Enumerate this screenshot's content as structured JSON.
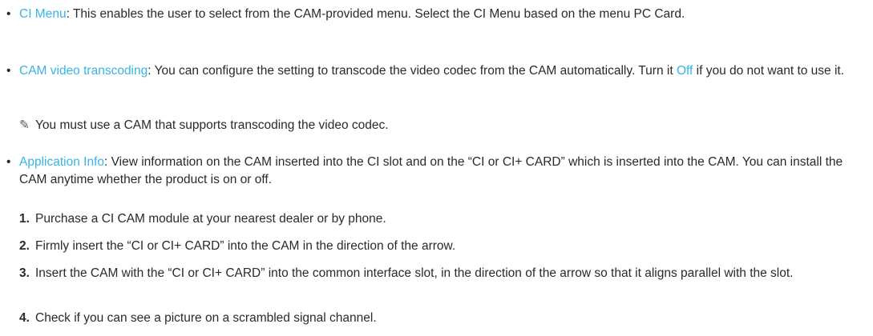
{
  "items": [
    {
      "term": "CI Menu",
      "text": ": This enables the user to select from the CAM-provided menu. Select the CI Menu based on the menu PC Card."
    },
    {
      "term": "CAM video transcoding",
      "text_before": ": You can configure the setting to transcode the video codec from the CAM automatically. Turn it ",
      "accent": "Off",
      "text_after": " if you do not want to use it."
    },
    {
      "term": "Application Info",
      "text": ": View information on the CAM inserted into the CI slot and on the “CI or CI+ CARD” which is inserted into the CAM. You can install the CAM anytime whether the product is on or off."
    }
  ],
  "note": {
    "icon": "pencil-note-icon",
    "glyph": "✎",
    "text": "You must use a CAM that supports transcoding the video codec."
  },
  "bullet_glyph": "•",
  "steps": [
    {
      "num": "1.",
      "text": "Purchase a CI CAM module at your nearest dealer or by phone."
    },
    {
      "num": "2.",
      "text": "Firmly insert the “CI or CI+ CARD” into the CAM in the direction of the arrow."
    },
    {
      "num": "3.",
      "text": "Insert the CAM with the “CI or CI+ CARD” into the common interface slot, in the direction of the arrow so that it aligns parallel with the slot."
    },
    {
      "num": "4.",
      "text": "Check if you can see a picture on a scrambled signal channel."
    }
  ],
  "colors": {
    "accent": "#38b4e6",
    "text": "#2a2a2a"
  }
}
